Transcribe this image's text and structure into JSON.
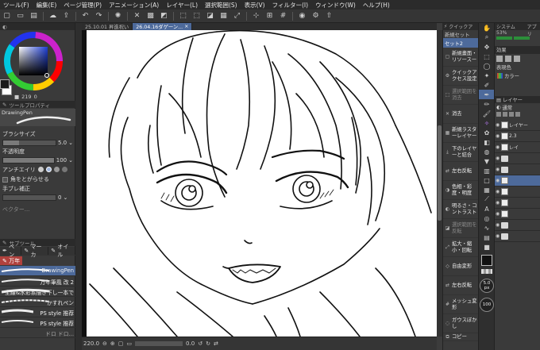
{
  "menubar": {
    "items": [
      "ツール(F)",
      "編集(E)",
      "ページ管理(P)",
      "アニメーション(A)",
      "レイヤー(L)",
      "選択範囲(S)",
      "表示(V)",
      "フィルター(I)",
      "ウィンドウ(W)",
      "ヘルプ(H)"
    ]
  },
  "document_tabs": {
    "tab1": "25.10.01 昇進祝い",
    "tab2": "26.04.16ダゲーン..."
  },
  "color": {
    "current": "#1a1a1a",
    "sub": "#ffffff",
    "value_readout": "219",
    "value_readout_2": "0"
  },
  "tool_property": {
    "header": "ツールプロパティ",
    "brush_name": "DrawingPen",
    "brush_size_label": "ブラシサイズ",
    "brush_size_value": "5.0",
    "opacity_label": "不透明度",
    "opacity_value": "100",
    "antialias_label": "アンチエイリ",
    "round_corners_label": "角をとがらせる",
    "stabilization_label": "手ブレ補正",
    "stabilization_value": "0",
    "vector_label": "ベクター..."
  },
  "sub_tool": {
    "header": "サブツール",
    "tabs": [
      "ペン",
      "マーカ",
      "オイル"
    ],
    "group_label": "万年",
    "brushes": [
      {
        "name": "DrawingPen"
      },
      {
        "name": "万年筆風 改 2"
      },
      {
        "name": "主線&水彩系描き下し一本で"
      },
      {
        "name": "かすれペン"
      },
      {
        "name": "PS style 推荐"
      },
      {
        "name": "PS style 推荐"
      },
      {
        "name": "ドロ ドロ..."
      }
    ]
  },
  "statusbar": {
    "zoom": "220.0",
    "angle": "0.0"
  },
  "quick_access": {
    "strip_label": "クイックア",
    "set_label": "新規セット",
    "set_name": "セット2",
    "items": [
      {
        "label": "新規畫面・リソースー",
        "enabled": true
      },
      {
        "label": "クイックアクセス設定",
        "enabled": true
      },
      {
        "label": "選択範囲を消去",
        "enabled": false
      },
      {
        "label": "消去",
        "enabled": true
      },
      {
        "label": "新規ラスターレイヤー",
        "enabled": true
      },
      {
        "label": "下のレイヤーと結合",
        "enabled": true
      },
      {
        "label": "左右反転",
        "enabled": true
      },
      {
        "label": "色相・彩度・明度",
        "enabled": true
      },
      {
        "label": "明るさ・コントラスト",
        "enabled": true
      },
      {
        "label": "選択範囲を反転",
        "enabled": false
      },
      {
        "label": "拡大・縮小・回転",
        "enabled": true
      },
      {
        "label": "自由変形",
        "enabled": true
      },
      {
        "label": "左右反転",
        "enabled": true
      },
      {
        "label": "メッシュ変形",
        "enabled": true
      },
      {
        "label": "ガウスぼかし",
        "enabled": true
      },
      {
        "label": "コピー",
        "enabled": true
      }
    ]
  },
  "right_panel": {
    "system_label": "システム 53%",
    "app_label": "アプリ",
    "effect_label": "効果",
    "display_color_label": "表現色",
    "color_mode": "カラー",
    "layer_header": "レイヤー",
    "blend_mode": "通常",
    "brush_size_readout": "5.0",
    "brush_size_unit": "px",
    "opacity_readout": "100",
    "layers": [
      {
        "name": "レイヤー",
        "type": "thumb"
      },
      {
        "name": "2.3",
        "type": "thumb"
      },
      {
        "name": "レイ",
        "type": "thumb"
      },
      {
        "name": "",
        "type": "folder"
      },
      {
        "name": "",
        "type": "folder"
      },
      {
        "name": "",
        "type": "thumb"
      },
      {
        "name": "",
        "type": "thumb"
      },
      {
        "name": "",
        "type": "thumb"
      },
      {
        "name": "",
        "type": "thumb"
      },
      {
        "name": "",
        "type": "folder"
      },
      {
        "name": "",
        "type": "folder"
      }
    ]
  }
}
